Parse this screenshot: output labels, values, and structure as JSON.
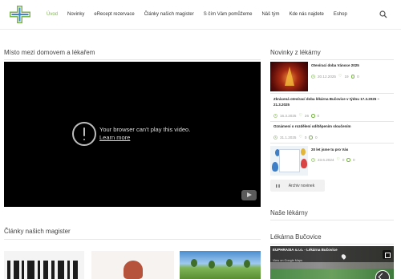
{
  "nav": {
    "items": [
      "Úvod",
      "Novinky",
      "eRecept rezervace",
      "Články našich magister",
      "S čím Vám pomůžeme",
      "Náš tým",
      "Kde nás najdete",
      "Eshop"
    ],
    "active_index": 0,
    "active_color": "#7ab648",
    "search_icon": "search-icon"
  },
  "main": {
    "video_section_title": "Místo mezi domovem a lékařem",
    "video": {
      "error_message": "Your browser can't play this video.",
      "learn_more": "Learn more"
    },
    "articles_section_title": "Články našich magister"
  },
  "sidebar": {
    "news_title": "Novinky z lékárny",
    "news": [
      {
        "title": "Otevírací doba Vánoce 2025",
        "date": "20.12.2025",
        "likes": "19",
        "comments": "0"
      },
      {
        "title": "Zkrácená otevírací doba lékárna Bučovice v týdnu 17.3.2025 – 21.3.2025",
        "date": "16.3.2025",
        "likes": "26",
        "comments": "0"
      },
      {
        "title": "Oznámení o rozdělení odštěpením sloučením",
        "date": "31.1.2025",
        "likes": "0",
        "comments": "0"
      },
      {
        "title": "20 let jsme tu pro Vás",
        "date": "23.6.2024",
        "likes": "0",
        "comments": "0"
      }
    ],
    "archive_button": "Archiv novinek",
    "pharmacy_title": "Naše lékárny",
    "location_title": "Lékárna Bučovice",
    "map": {
      "place_name": "EUPHRASIA s.r.o. - Lékárna Bučovice",
      "view_link": "View on Google Maps"
    }
  }
}
